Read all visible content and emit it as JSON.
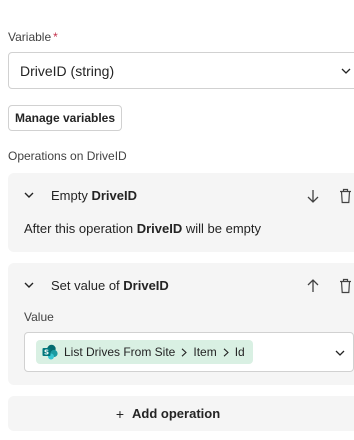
{
  "variable": {
    "label": "Variable",
    "required_mark": "*",
    "selected": "DriveID (string)"
  },
  "manage_variables_label": "Manage variables",
  "operations_label": "Operations on DriveID",
  "operations": [
    {
      "title_prefix": "Empty ",
      "title_var": "DriveID",
      "description_prefix": "After this operation ",
      "description_var": "DriveID",
      "description_suffix": " will be empty",
      "move_icon": "arrow-down-icon",
      "delete_icon": "trash-icon"
    },
    {
      "title_prefix": "Set value of ",
      "title_var": "DriveID",
      "value_label": "Value",
      "value_token": {
        "icon": "sharepoint-icon",
        "parts": [
          "List Drives From Site",
          "Item",
          "Id"
        ]
      },
      "move_icon": "arrow-up-icon",
      "delete_icon": "trash-icon"
    }
  ],
  "add_operation_label": "Add operation",
  "colors": {
    "required": "#c4314b",
    "card_bg": "#f5f5f5",
    "token_bg": "#d9f0e3",
    "border": "#d1d1d1"
  }
}
